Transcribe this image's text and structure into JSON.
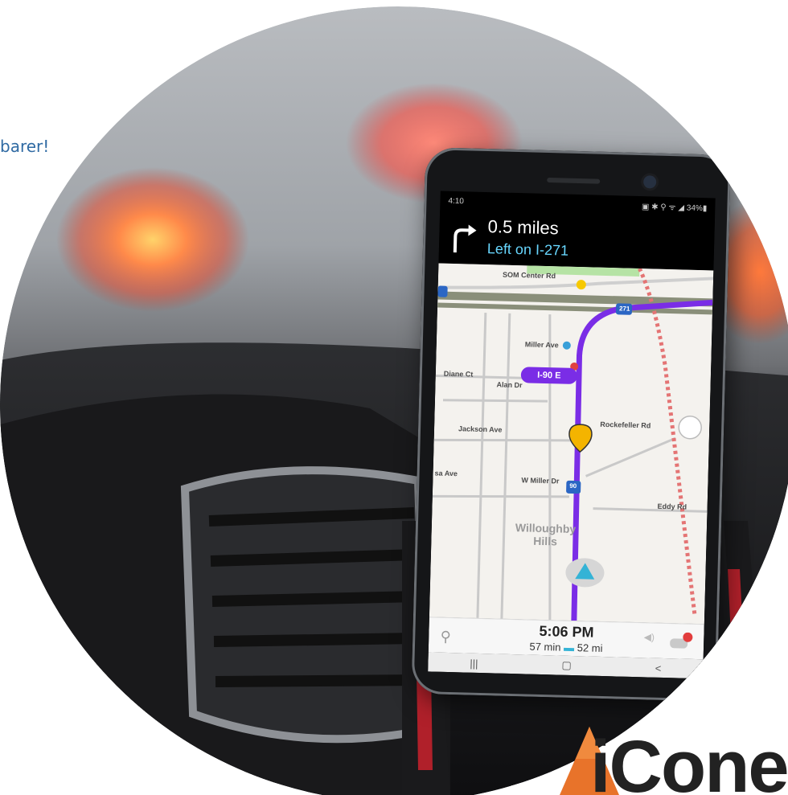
{
  "side_text": "barer!",
  "phone": {
    "status": {
      "time": "4:10",
      "icons": "▣ ✱ ⚲ ᯤ ◢ 34%▮"
    },
    "navigation": {
      "turn_icon": "turn-right-arrow-icon",
      "distance": "0.5 miles",
      "instruction": "Left on I-271"
    },
    "map": {
      "labels": {
        "som_center": "SOM Center Rd",
        "miller_ave": "Miller Ave",
        "diane_ct": "Diane Ct",
        "alan_dr": "Alan Dr",
        "jackson_ave": "Jackson Ave",
        "rockefeller": "Rockefeller Rd",
        "w_miller": "W Miller Dr",
        "eddy_rd": "Eddy Rd",
        "sa_ave": "sa Ave",
        "willoughby": "Willoughby",
        "hills": "Hills",
        "shield_271": "271",
        "shield_90": "90",
        "shield_left": "90"
      },
      "route_pill": "I-90 E",
      "route_color": "#7a2de6"
    },
    "bottom_bar": {
      "eta_time": "5:06 PM",
      "eta_duration": "57 min",
      "eta_distance": "52 mi",
      "car_badge": "1"
    },
    "android_nav": {
      "recents": "|||",
      "home": "▢",
      "back": "<"
    }
  },
  "logo": {
    "text": "iCone",
    "accent_color": "#e8732a"
  }
}
